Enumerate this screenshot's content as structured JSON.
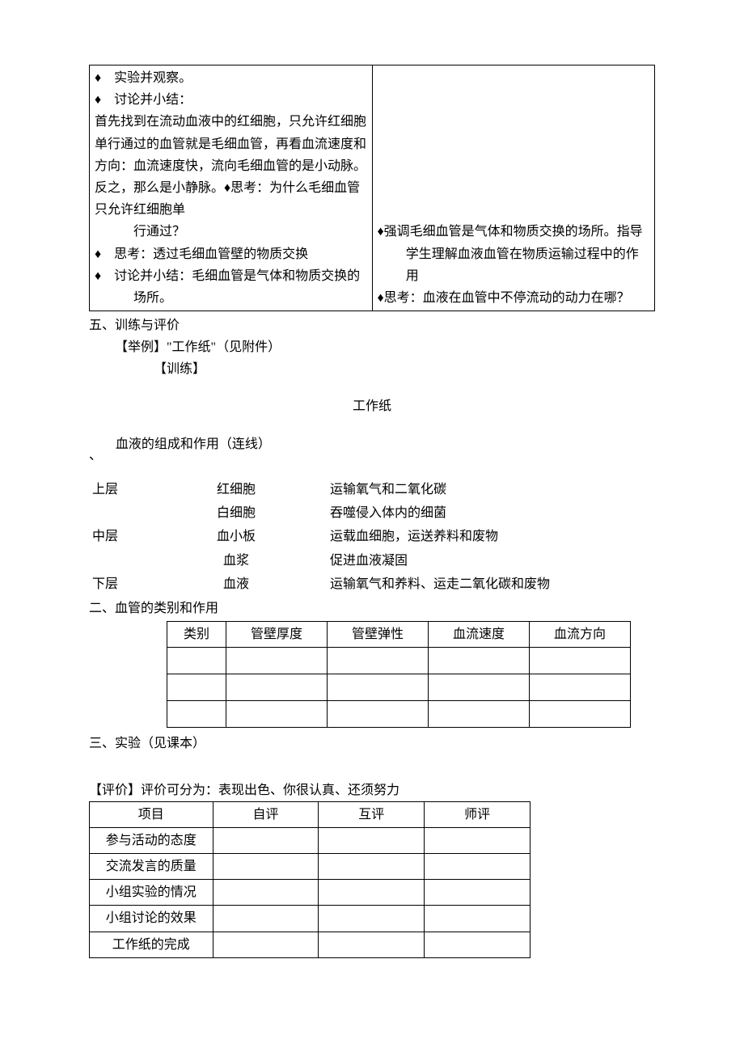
{
  "topTable": {
    "left": {
      "bullet1": "实验并观察。",
      "bullet2": "讨论并小结：",
      "para1": "首先找到在流动血液中的红细胞，只允许红细胞单行通过的血管就是毛细血管，再看血流速度和方向：血流速度快，流向毛细血管的是小动脉。反之，那么是小静脉。♦思考：为什么毛细血管只允许红细胞单",
      "para1_cont": "行通过？",
      "bullet3": "思考：透过毛细血管壁的物质交换",
      "bullet4_a": "讨论并小结：毛细血管是气体和物质交换的",
      "bullet4_b": "场所。"
    },
    "right": {
      "bullet1_a": "强调毛细血管是气体和物质交换的场所。指导",
      "bullet1_b": "学生理解血液血管在物质运输过程中的作",
      "bullet1_c": "用",
      "bullet2": "思考：血液在血管中不停流动的动力在哪？"
    }
  },
  "section5": {
    "title": "五、训练与评价",
    "example": "【举例】\"工作纸\"（见附件）",
    "train": "【训练】"
  },
  "worksheet": {
    "title": "工作纸",
    "q1_mark": "、",
    "q1_title": "血液的组成和作用（连线）",
    "rows": [
      {
        "c1": "上层",
        "c2": "红细胞",
        "c3": "运输氧气和二氧化碳"
      },
      {
        "c1": "",
        "c2": "白细胞",
        "c3": "吞噬侵入体内的细菌"
      },
      {
        "c1": "中层",
        "c2": "血小板",
        "c3": "运载血细胞，运送养料和废物"
      },
      {
        "c1": "",
        "c2": "血浆",
        "c3": "促进血液凝固"
      },
      {
        "c1": "下层",
        "c2": "血液",
        "c3": "运输氧气和养料、运走二氧化碳和废物"
      }
    ]
  },
  "section2": {
    "title": "二、血管的类别和作用",
    "headers": [
      "类别",
      "管壁厚度",
      "管壁弹性",
      "血流速度",
      "血流方向"
    ]
  },
  "section3": {
    "title": "三、实验（见课本）"
  },
  "evaluation": {
    "lead": "【评价】评价可分为：表现出色、你很认真、还须努力",
    "headers": [
      "项目",
      "自评",
      "互评",
      "师评"
    ],
    "rows": [
      "参与活动的态度",
      "交流发言的质量",
      "小组实验的情况",
      "小组讨论的效果",
      "工作纸的完成"
    ]
  }
}
